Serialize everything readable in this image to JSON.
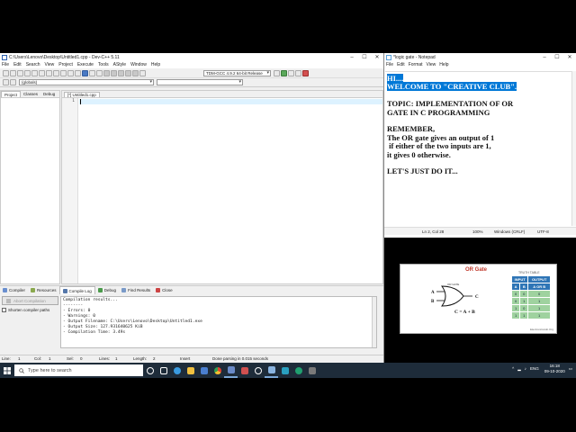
{
  "devcpp": {
    "title": "C:\\Users\\Lenovo\\Desktop\\Untitled1.cpp - Dev-C++ 5.11",
    "menu": [
      "File",
      "Edit",
      "Search",
      "View",
      "Project",
      "Execute",
      "Tools",
      "AStyle",
      "Window",
      "Help"
    ],
    "compiler_select": "TDM-GCC 4.9.2 64-bit Release",
    "globals_select": "(globals)",
    "project_tabs": [
      "Project",
      "Classes",
      "Debug"
    ],
    "editor_tab": "[*] Untitled1.cpp",
    "line_number": "1",
    "bottom_tabs": [
      "Compiler",
      "Resources",
      "Compile Log",
      "Debug",
      "Find Results",
      "Close"
    ],
    "abort_label": "Abort Compilation",
    "shorten_label": "Shorten compiler paths",
    "log_lines": [
      "Compilation results...",
      "--------",
      "- Errors: 0",
      "- Warnings: 0",
      "- Output Filename: C:\\Users\\Lenovo\\Desktop\\Untitled1.exe",
      "- Output Size: 127.931640625 KiB",
      "- Compilation Time: 3.49s"
    ],
    "status": {
      "line": "Line:",
      "line_val": "1",
      "col": "Col:",
      "col_val": "1",
      "sel": "Sel:",
      "sel_val": "0",
      "lines": "Lines:",
      "lines_val": "1",
      "length": "Length:",
      "length_val": "2",
      "mode": "Insert",
      "msg": "Done parsing in 0.015 seconds"
    }
  },
  "notepad": {
    "title": "*logic gate - Notepad",
    "menu": [
      "File",
      "Edit",
      "Format",
      "View",
      "Help"
    ],
    "lines": [
      "HI....",
      "WELCOME TO \"CREATIVE CLUB\".",
      "",
      "TOPIC: IMPLEMENTATION OF OR",
      "GATE IN C PROGRAMMING",
      "",
      "REMEMBER,",
      "The OR gate gives an output of 1",
      " if either of the two inputs are 1,",
      "it gives 0 otherwise.",
      "",
      "LET'S JUST DO IT..."
    ],
    "status": {
      "pos": "Ln 2, Col 28",
      "zoom": "100%",
      "eol": "Windows (CRLF)",
      "enc": "UTF-8"
    }
  },
  "or_image": {
    "title": "OR Gate",
    "gate_label": "OR GATE",
    "input_a": "A",
    "input_b": "B",
    "output": "C",
    "equation": "C = A + B",
    "table_title": "TRUTH TABLE",
    "headers": [
      "INPUT",
      "OUTPUT"
    ],
    "subheaders": [
      "A",
      "B",
      "A OR B"
    ],
    "rows": [
      [
        "0",
        "0",
        "0"
      ],
      [
        "0",
        "1",
        "1"
      ],
      [
        "1",
        "0",
        "1"
      ],
      [
        "1",
        "1",
        "1"
      ]
    ],
    "credit": "ElectronicsHub.Org"
  },
  "taskbar": {
    "search_placeholder": "Type here to search",
    "time": "16:18",
    "date": "09-10-2020",
    "lang": "ENG"
  },
  "colors": {
    "selection": "#0078d7",
    "taskbar": "#1e2c3a",
    "or_title": "#c0392b",
    "table_head": "#2e75b6",
    "table_cell": "#9fd29f"
  }
}
